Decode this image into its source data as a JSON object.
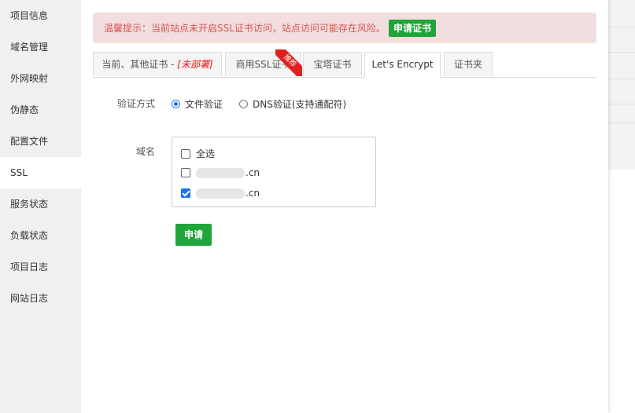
{
  "sidebar": {
    "items": [
      {
        "label": "项目信息"
      },
      {
        "label": "域名管理"
      },
      {
        "label": "外网映射"
      },
      {
        "label": "伪静态"
      },
      {
        "label": "配置文件"
      },
      {
        "label": "SSL"
      },
      {
        "label": "服务状态"
      },
      {
        "label": "负载状态"
      },
      {
        "label": "项目日志"
      },
      {
        "label": "网站日志"
      }
    ],
    "active": "SSL"
  },
  "alert": {
    "message": "温馨提示：当前站点未开启SSL证书访问，站点访问可能存在风险。",
    "button": "申请证书"
  },
  "tabs": [
    {
      "label": "当前、其他证书 - ",
      "status": "[未部署]"
    },
    {
      "label": "商用SSL证书",
      "badge": "推荐"
    },
    {
      "label": "宝塔证书"
    },
    {
      "label": "Let's Encrypt"
    },
    {
      "label": "证书夹"
    }
  ],
  "active_tab": "Let's Encrypt",
  "form": {
    "verify_label": "验证方式",
    "verify_options": [
      {
        "label": "文件验证",
        "checked": true
      },
      {
        "label": "DNS验证(支持通配符)",
        "checked": false
      }
    ],
    "domain_label": "域名",
    "domains": [
      {
        "label": "全选",
        "checked": false
      },
      {
        "label": ".cn",
        "checked": false
      },
      {
        "label": ".cn",
        "checked": true
      }
    ],
    "submit": "申请"
  },
  "colors": {
    "accent_green": "#20a53a",
    "alert_bg": "#f2dede",
    "alert_text": "#d9534f",
    "checkbox_blue": "#1a73e8"
  }
}
